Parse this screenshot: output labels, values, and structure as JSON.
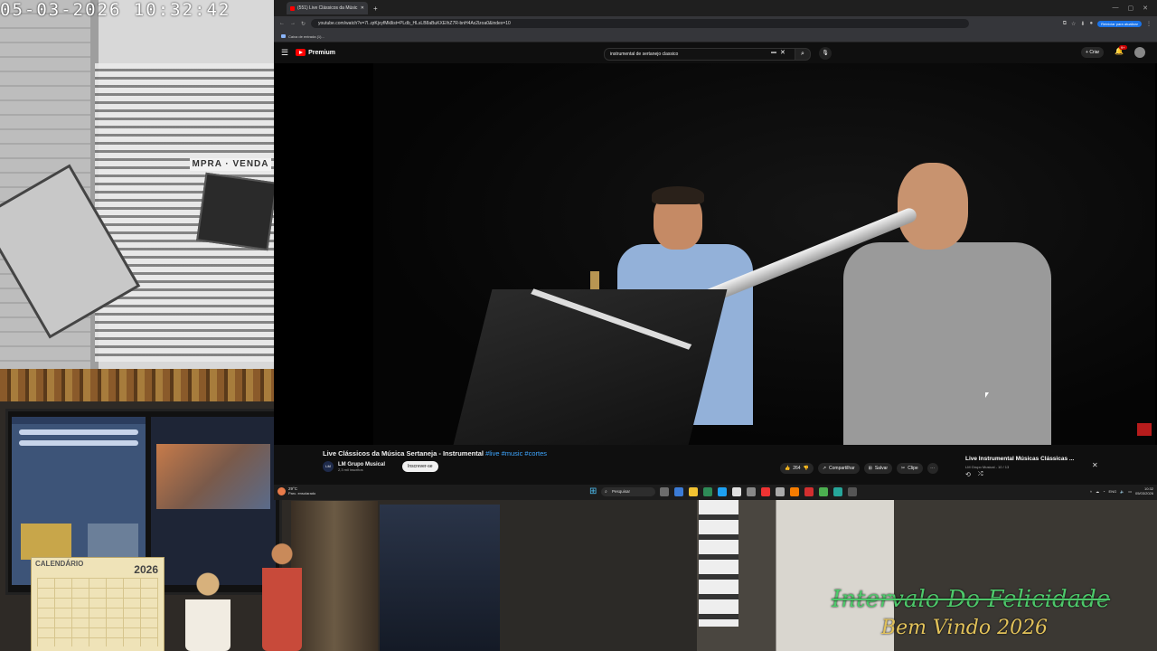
{
  "camera": {
    "timestamp": "05-03-2026  10:32:42",
    "sign": "MPRA · VENDA"
  },
  "desk": {
    "calendar_title": "CALENDÁRIO",
    "calendar_year": "2026"
  },
  "overlay": {
    "title": "Intervalo Do Felicidade",
    "subtitle": "Bem Vindo 2026"
  },
  "browser": {
    "tab_title": "(551) Live Clássicos da Músic",
    "new_tab": "+",
    "url": "youtube.com/watch?v=7l..qrKjvyfMkllist=PLdb_HLsLB8aBuKXEIhZ7R-bnH4Ax2lzoa0&index=10",
    "bookmark": "Caixa de entrada (1)...",
    "reload_label": "Reiniciar para atualizar"
  },
  "youtube": {
    "premium": "Premium",
    "search_query": "instrumental de sertanejo classico",
    "create_label": "Criar",
    "notification_count": "9+"
  },
  "video": {
    "title": "Live Clássicos da Música Sertaneja - Instrumental",
    "tags": "#live #music #cortes",
    "channel": "LM Grupo Musical",
    "subscribers": "2,3 mil inscritos",
    "subscribe_label": "Inscrever-se",
    "likes": "264",
    "share_label": "Compartilhar",
    "save_label": "Salvar",
    "clip_label": "Clipe"
  },
  "playlist": {
    "title": "Live Instrumental Músicas Clássicas ...",
    "subtitle": "LM Grupo Musical - 10 / 13"
  },
  "taskbar": {
    "temp": "29°C",
    "weather": "Parc. ensolarado",
    "search_label": "Pesquisar",
    "lang": "ENG",
    "time": "10:32",
    "date": "05/03/2026"
  }
}
